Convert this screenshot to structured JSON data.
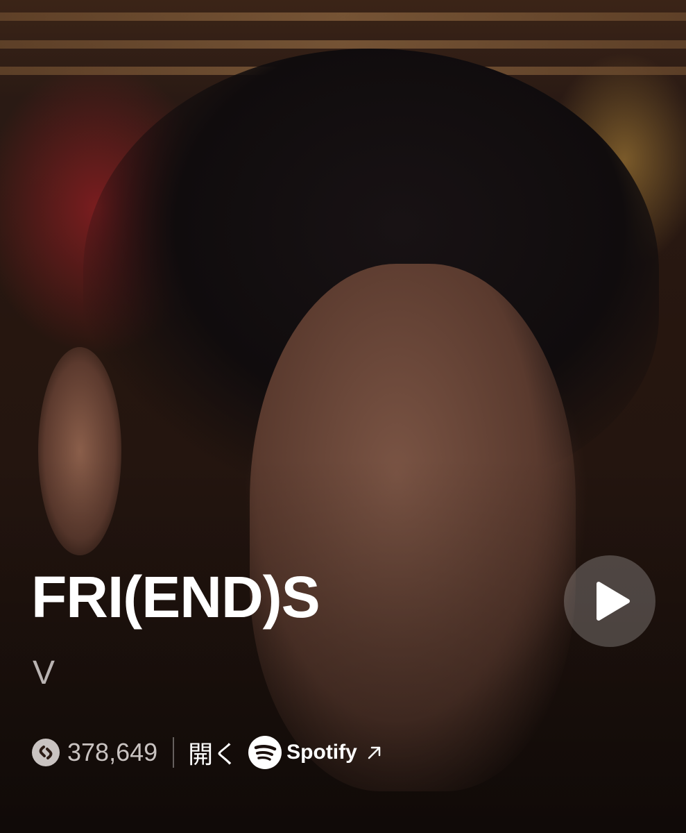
{
  "track": {
    "title": "FRI(END)S",
    "artist": "V"
  },
  "stats": {
    "shazam_count": "378,649"
  },
  "open_in": {
    "label": "開く",
    "service": "Spotify"
  },
  "icons": {
    "play": "play-icon",
    "shazam": "shazam-icon",
    "spotify": "spotify-icon",
    "external": "arrow-up-right-icon"
  },
  "colors": {
    "title": "#ffffff",
    "artist": "#b9b3b2",
    "count": "#c9c3c1"
  }
}
